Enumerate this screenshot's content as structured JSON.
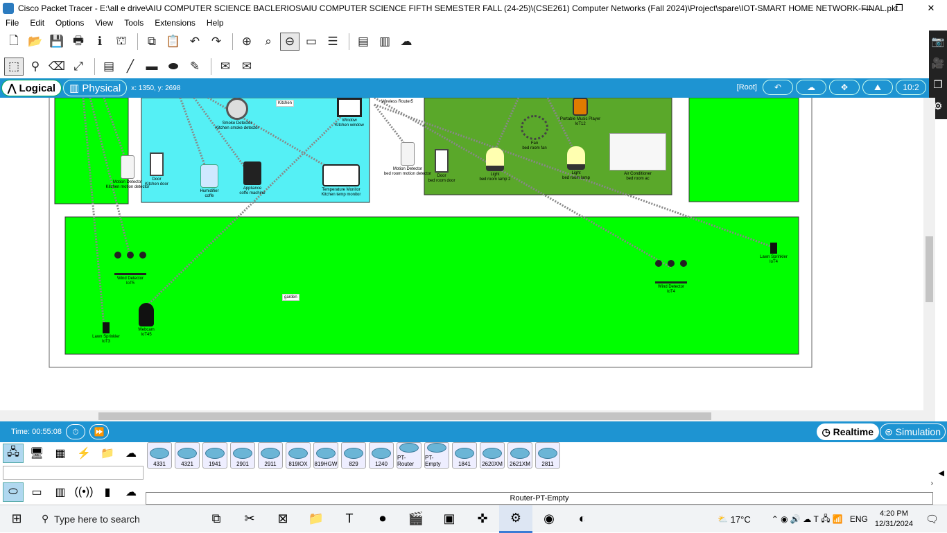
{
  "window": {
    "title": "Cisco Packet Tracer - E:\\all e drive\\AIU COMPUTER SCIENCE BACLERIOS\\AIU COMPUTER SCIENCE FIFTH SEMESTER FALL (24-25)\\(CSE261) Computer Networks (Fall 2024)\\Project\\spare\\IOT-SMART HOME NETWORK-FINAL.pkt",
    "minimize": "—",
    "restore": "❐",
    "close": "✕"
  },
  "menu": [
    "File",
    "Edit",
    "Options",
    "View",
    "Tools",
    "Extensions",
    "Help"
  ],
  "modebar": {
    "logical": "Logical",
    "physical": "Physical",
    "coords": "x: 1350, y: 2698",
    "root": "[Root]",
    "clock_partial": "10:2"
  },
  "canvas": {
    "zones": {
      "kitchen_label": "Kitchen",
      "garden_label": "garden",
      "router_label": "Wireless Router5"
    },
    "devices": [
      {
        "name": "Smoke Detector",
        "sub": "Kitchen smoke detector"
      },
      {
        "name": "Window",
        "sub": "Kitchen window"
      },
      {
        "name": "Motion Detector",
        "sub": "Kitchen motion detector"
      },
      {
        "name": "Door",
        "sub": "Kitchen door"
      },
      {
        "name": "Humidifier",
        "sub": "coffe"
      },
      {
        "name": "Appliance",
        "sub": "coffe machine"
      },
      {
        "name": "Temperature Monitor",
        "sub": "Kitchen temp monitor"
      },
      {
        "name": "Motion Detector",
        "sub": "bed room motion detector"
      },
      {
        "name": "Door",
        "sub": "bed room door"
      },
      {
        "name": "Light",
        "sub": "bed room lamp 2"
      },
      {
        "name": "Fan",
        "sub": "bed room fan"
      },
      {
        "name": "Portable Music Player",
        "sub": "IoT12"
      },
      {
        "name": "Light",
        "sub": "bed room lamp"
      },
      {
        "name": "Air Conditioner",
        "sub": "bed room ac"
      },
      {
        "name": "Wind Detector",
        "sub": "IoT5"
      },
      {
        "name": "Webcam",
        "sub": "IoT45"
      },
      {
        "name": "Lawn Sprinkler",
        "sub": "IoT3"
      },
      {
        "name": "Wind Detector",
        "sub": "IoT4"
      },
      {
        "name": "Lawn Sprinkler",
        "sub": "IoT4"
      }
    ]
  },
  "timebar": {
    "time": "Time: 00:55:08",
    "realtime": "Realtime",
    "simulation": "Simulation"
  },
  "models": [
    "4331",
    "4321",
    "1941",
    "2901",
    "2911",
    "819IOX",
    "819HGW",
    "829",
    "1240",
    "PT-Router",
    "PT-Empty",
    "1841",
    "2620XM",
    "2621XM",
    "2811"
  ],
  "selected_model": "Router-PT-Empty",
  "taskbar": {
    "search_placeholder": "Type here to search",
    "temperature": "17°C",
    "language": "ENG",
    "time": "4:20 PM",
    "date": "12/31/2024"
  }
}
